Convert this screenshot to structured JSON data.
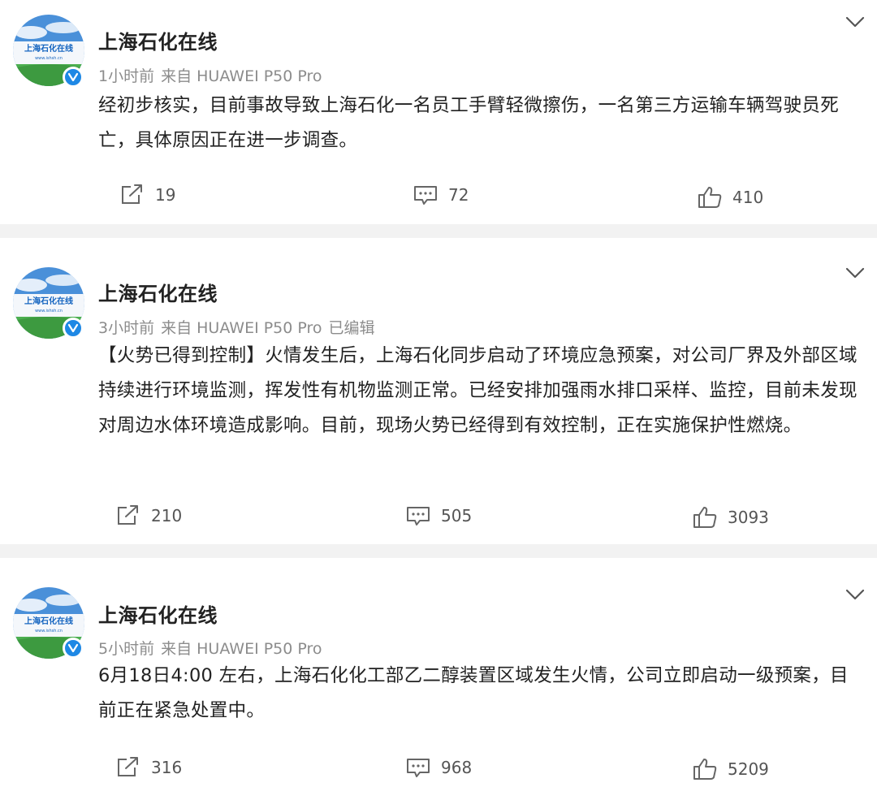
{
  "posts": [
    {
      "username": "上海石化在线",
      "time": "1小时前",
      "source": "来自 HUAWEI P50 Pro",
      "edited": "",
      "content": "经初步核实，目前事故导致上海石化一名员工手臂轻微擦伤，一名第三方运输车辆驾驶员死亡，具体原因正在进一步调查。",
      "reposts": "19",
      "comments": "72",
      "likes": "410"
    },
    {
      "username": "上海石化在线",
      "time": "3小时前",
      "source": "来自 HUAWEI P50 Pro",
      "edited": "已编辑",
      "content": "【火势已得到控制】火情发生后，上海石化同步启动了环境应急预案，对公司厂界及外部区域持续进行环境监测，挥发性有机物监测正常。已经安排加强雨水排口采样、监控，目前未发现对周边水体环境造成影响。目前，现场火势已经得到有效控制，正在实施保护性燃烧。",
      "reposts": "210",
      "comments": "505",
      "likes": "3093"
    },
    {
      "username": "上海石化在线",
      "time": "5小时前",
      "source": "来自 HUAWEI P50 Pro",
      "edited": "",
      "content": "6月18日4:00 左右，上海石化化工部乙二醇装置区域发生火情，公司立即启动一级预案，目前正在紧急处置中。",
      "reposts": "316",
      "comments": "968",
      "likes": "5209"
    }
  ],
  "avatar_text": "上海石化在线",
  "avatar_url_text": "www.ishsh.cn",
  "icons": {
    "repost": "repost-icon",
    "comment": "comment-icon",
    "like": "like-icon",
    "more": "chevron-down-icon",
    "verified": "verified-icon"
  },
  "colors": {
    "background": "#f2f2f2",
    "card": "#ffffff",
    "verified": "#1e88e5",
    "meta": "#8c8c8c"
  }
}
